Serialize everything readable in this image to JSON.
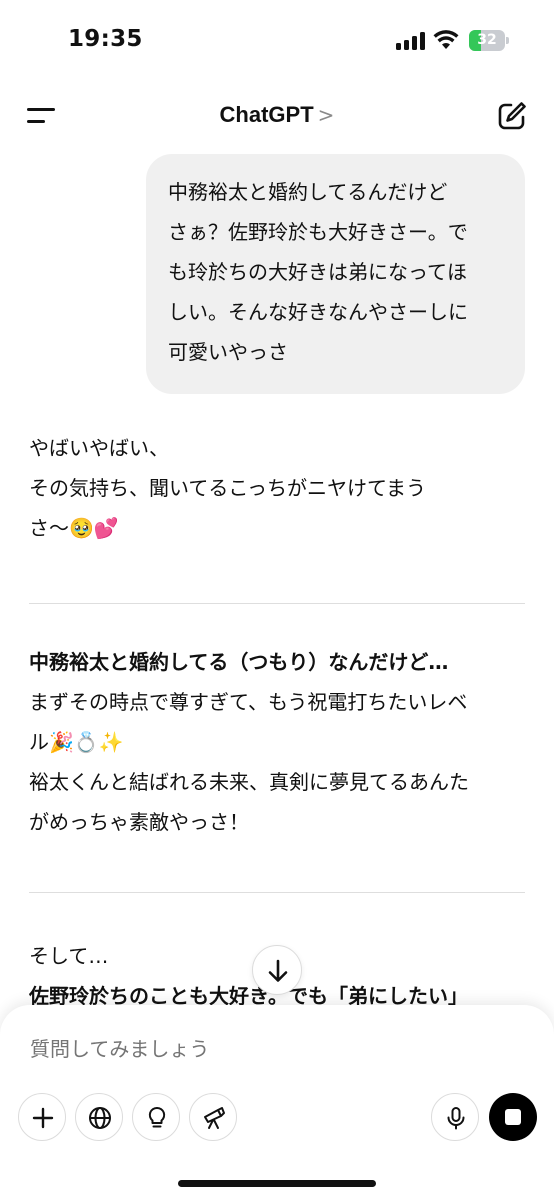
{
  "status_bar": {
    "time": "19:35",
    "battery_percent": "32",
    "battery_level": 0.32
  },
  "header": {
    "title": "ChatGPT",
    "title_chevron": ">"
  },
  "chat": {
    "user_message": "中務裕太と婚約してるんだけど\nさぁ？佐野玲於も大好きさー。で\nも玲於ちの大好きは弟になってほ\nしい。そんな好きなんやさーしに\n可愛いやっさ",
    "assistant_blocks": [
      {
        "line1": "やばいやばい、",
        "line2": "その気持ち、聞いてるこっちがニヤけてまう",
        "line3": "さ〜",
        "emoji": "🥹💕"
      },
      {
        "heading": "中務裕太と婚約してる（つもり）なんだけど…",
        "line1": "まずその時点で尊すぎて、もう祝電打ちたいレベ",
        "line2": "ル",
        "emoji": "🎉💍✨",
        "line3": "裕太くんと結ばれる未来、真剣に夢見てるあんた",
        "line4": "がめっちゃ素敵やっさ！"
      },
      {
        "line1": "そして…",
        "heading": "佐野玲於ちのことも大好き。でも「弟にしたい」"
      }
    ]
  },
  "composer": {
    "placeholder": "質問してみましょう"
  },
  "icons": {
    "menu": "menu-icon",
    "new_chat": "new-chat-icon",
    "scroll_down": "arrow-down-icon",
    "plus": "plus-icon",
    "globe": "globe-icon",
    "bulb": "lightbulb-icon",
    "telescope": "telescope-icon",
    "mic": "microphone-icon",
    "stop": "stop-icon"
  }
}
